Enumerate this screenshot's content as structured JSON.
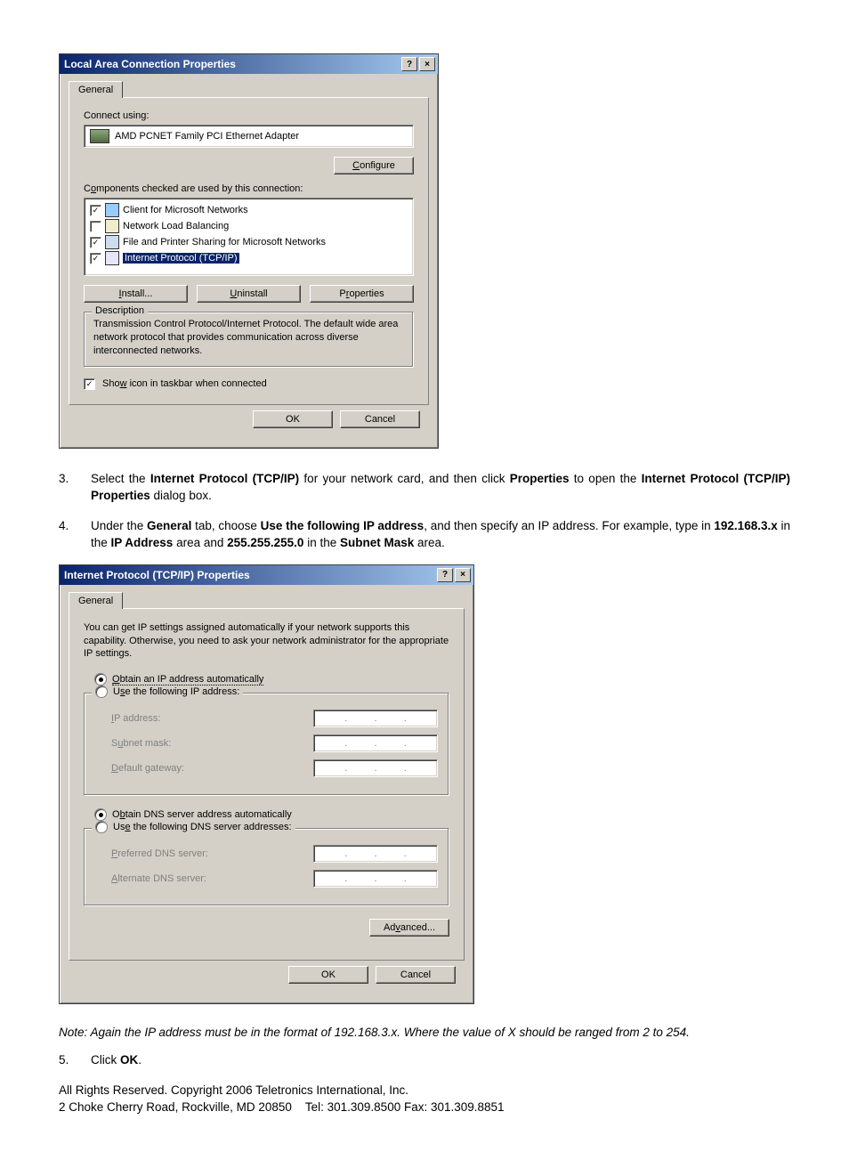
{
  "dialog1": {
    "title": "Local Area Connection Properties",
    "tab": "General",
    "connectUsing": "Connect using:",
    "adapter": "AMD PCNET Family PCI Ethernet Adapter",
    "configure": "Configure",
    "componentsLabel": "Components checked are used by this connection:",
    "items": [
      {
        "checked": true,
        "label": "Client for Microsoft Networks"
      },
      {
        "checked": false,
        "label": "Network Load Balancing"
      },
      {
        "checked": true,
        "label": "File and Printer Sharing for Microsoft Networks"
      },
      {
        "checked": true,
        "label": "Internet Protocol (TCP/IP)"
      }
    ],
    "install": "Install...",
    "uninstall": "Uninstall",
    "properties": "Properties",
    "descLegend": "Description",
    "descText": "Transmission Control Protocol/Internet Protocol. The default wide area network protocol that provides communication across diverse interconnected networks.",
    "showIcon": "Show icon in taskbar when connected",
    "ok": "OK",
    "cancel": "Cancel"
  },
  "step3": {
    "num": "3.",
    "t1": "Select the ",
    "b1": "Internet Protocol (TCP/IP)",
    "t2": " for your network card, and then click ",
    "b2": "Properties",
    "t3": " to open the ",
    "b3": "Internet Protocol (TCP/IP) Properties",
    "t4": " dialog box."
  },
  "step4": {
    "num": "4.",
    "t1": "Under the ",
    "b1": "General",
    "t2": " tab, choose ",
    "b2": "Use the following IP address",
    "t3": ", and then specify an IP address. For example, type in ",
    "b3": "192.168.3.x",
    "t4": " in the ",
    "b4": "IP Address",
    "t5": " area and ",
    "b5": "255.255.255.0",
    "t6": " in the ",
    "b6": "Subnet Mask",
    "t7": " area."
  },
  "dialog2": {
    "title": "Internet Protocol (TCP/IP) Properties",
    "tab": "General",
    "intro": "You can get IP settings assigned automatically if your network supports this capability. Otherwise, you need to ask your network administrator for the appropriate IP settings.",
    "radioAuto": "Obtain an IP address automatically",
    "radioManual": "Use the following IP address:",
    "ip": "IP address:",
    "subnet": "Subnet mask:",
    "gateway": "Default gateway:",
    "radioDnsAuto": "Obtain DNS server address automatically",
    "radioDnsManual": "Use the following DNS server addresses:",
    "pref": "Preferred DNS server:",
    "alt": "Alternate DNS server:",
    "advanced": "Advanced...",
    "ok": "OK",
    "cancel": "Cancel"
  },
  "note": "Note: Again the IP address must be in the format of 192.168.3.x. Where the value of X should be ranged from 2 to 254.",
  "step5": {
    "num": "5.",
    "t1": "Click ",
    "b1": "OK",
    "t2": "."
  },
  "footer": {
    "line1": "All Rights Reserved. Copyright 2006 Teletronics International, Inc.",
    "line2": "2 Choke Cherry Road, Rockville, MD 20850    Tel: 301.309.8500 Fax: 301.309.8851"
  }
}
